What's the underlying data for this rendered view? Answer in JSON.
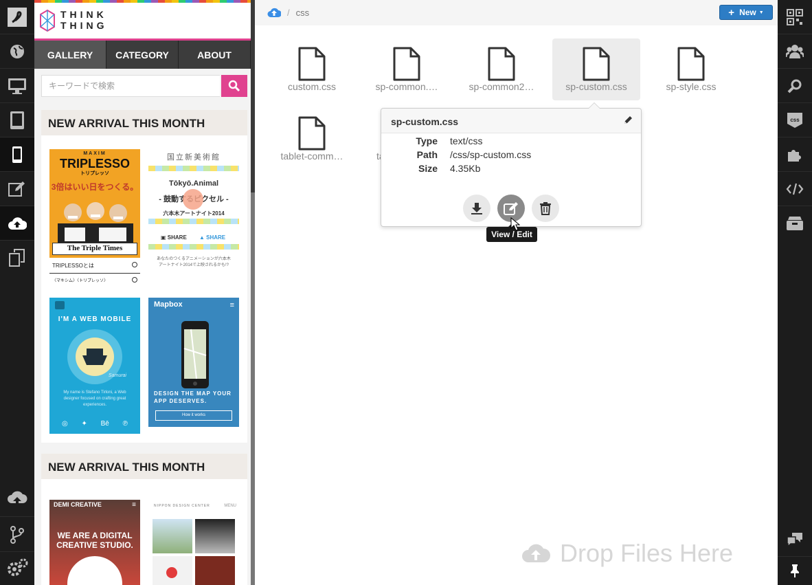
{
  "breadcrumb": {
    "root_icon": "cloud-upload-icon",
    "folder": "css"
  },
  "toolbar": {
    "new_label": "New"
  },
  "files": [
    {
      "name": "custom.css"
    },
    {
      "name": "sp-common.…"
    },
    {
      "name": "sp-common2…"
    },
    {
      "name": "sp-custom.css",
      "selected": true
    },
    {
      "name": "sp-style.css"
    },
    {
      "name": "tablet-comm…"
    },
    {
      "name": "ta"
    }
  ],
  "popover": {
    "title": "sp-custom.css",
    "type_label": "Type",
    "type_value": "text/css",
    "path_label": "Path",
    "path_value": "/css/sp-custom.css",
    "size_label": "Size",
    "size_value": "4.35Kb",
    "tooltip": "View / Edit"
  },
  "drop_zone": {
    "label": "Drop Files Here"
  },
  "preview": {
    "logo_line1": "THINK",
    "logo_line2": "THING",
    "menu": [
      "GALLERY",
      "CATEGORY",
      "ABOUT"
    ],
    "search_placeholder": "キーワードで検索",
    "section_title_1": "NEW ARRIVAL THIS MONTH",
    "section_title_2": "NEW ARRIVAL THIS MONTH",
    "thumbs": {
      "triplesso_top": "MAXIM",
      "triplesso_title": "TRIPLESSO",
      "triplesso_sub": "トリプレッソ",
      "triplesso_jp": "3倍はいい日をつくる。",
      "triplesso_times": "The Triple Times",
      "triplesso_link1": "TRIPLESSOとは",
      "triplesso_link2": "〈マキシム〉〈トリプレッソ〉",
      "tokyo_head": "国立新美術館",
      "tokyo_title": "Tōkyō.Animal",
      "tokyo_sub": "- 鼓動するピクセル -",
      "tokyo_event": "六本木アートナイト2014",
      "tokyo_share1": "SHARE",
      "tokyo_share2": "SHARE",
      "tokyo_text": "あなたのつくるアニメーションが六本木アートナイト2014で上映されるかも!?",
      "webmobile_title": "I'M A WEB MOBILE",
      "webmobile_sig": "Samurai",
      "webmobile_text": "My name is Stefano Tirloni, a Web designer focused on crafting great experiences.",
      "mapbox_title": "Mapbox",
      "mapbox_tag": "DESIGN THE MAP YOUR APP DESERVES.",
      "mapbox_btn": "How it works",
      "demi_title": "DEMI CREATIVE",
      "demi_text": "WE ARE A DIGITAL CREATIVE STUDIO.",
      "nippon_title": "NIPPON DESIGN CENTER",
      "nippon_menu": "MENU"
    }
  },
  "left_icons": [
    "app-logo-icon",
    "globe-icon",
    "desktop-icon",
    "tablet-icon",
    "phone-icon",
    "edit-icon",
    "cloud-upload-icon",
    "copy-icon",
    "cloud-publish-icon",
    "branch-icon",
    "settings-icon"
  ],
  "right_icons": [
    "qr-code-icon",
    "users-icon",
    "search-icon",
    "css-icon",
    "puzzle-icon",
    "code-icon",
    "archive-icon",
    "chat-icon",
    "pin-icon"
  ],
  "colors": {
    "accent": "#2d7dc5",
    "brand_pink": "#e0428f",
    "dark_bar": "#1c1c1c"
  }
}
